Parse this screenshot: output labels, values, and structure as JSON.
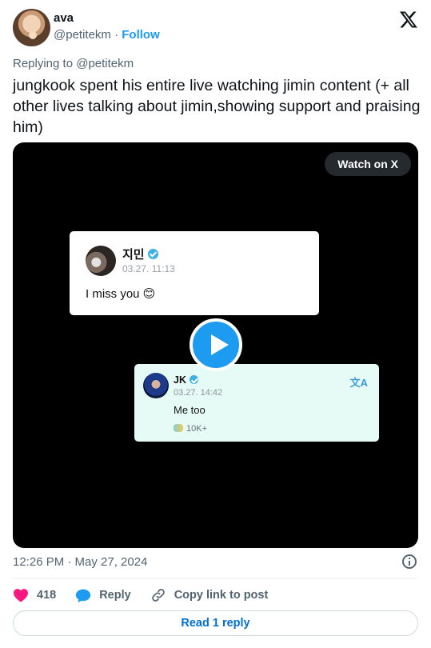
{
  "author": {
    "name": "ava",
    "handle": "@petitekm",
    "separator": "·",
    "follow_label": "Follow"
  },
  "tweet": {
    "replying_to": "Replying to @petitekm",
    "text": "jungkook spent his entire live watching jimin content (+ all other lives talking about jimin,showing support and praising him)"
  },
  "media": {
    "watch_label": "Watch on X",
    "message1": {
      "name": "지민",
      "time": "03.27. 11:13",
      "text": "I miss you 😊"
    },
    "message2": {
      "name": "JK",
      "time": "03.27. 14:42",
      "text": "Me too",
      "likes": "10K+",
      "translate": "文A"
    }
  },
  "footer": {
    "timestamp": "12:26 PM · May 27, 2024",
    "like_count": "418",
    "reply_label": "Reply",
    "copy_label": "Copy link to post",
    "read_replies_label": "Read 1 reply"
  },
  "colors": {
    "accent": "#1d9bf0",
    "like": "#f91880",
    "text": "#0f1419",
    "muted": "#536471",
    "media_bg": "#000000",
    "reply_bubble": "#e6fbf6"
  },
  "icons": [
    "x-logo-icon",
    "verified-icon",
    "play-icon",
    "info-icon",
    "heart-icon",
    "reply-bubble-icon",
    "link-icon",
    "translate-icon",
    "emoji-badge-icon"
  ]
}
